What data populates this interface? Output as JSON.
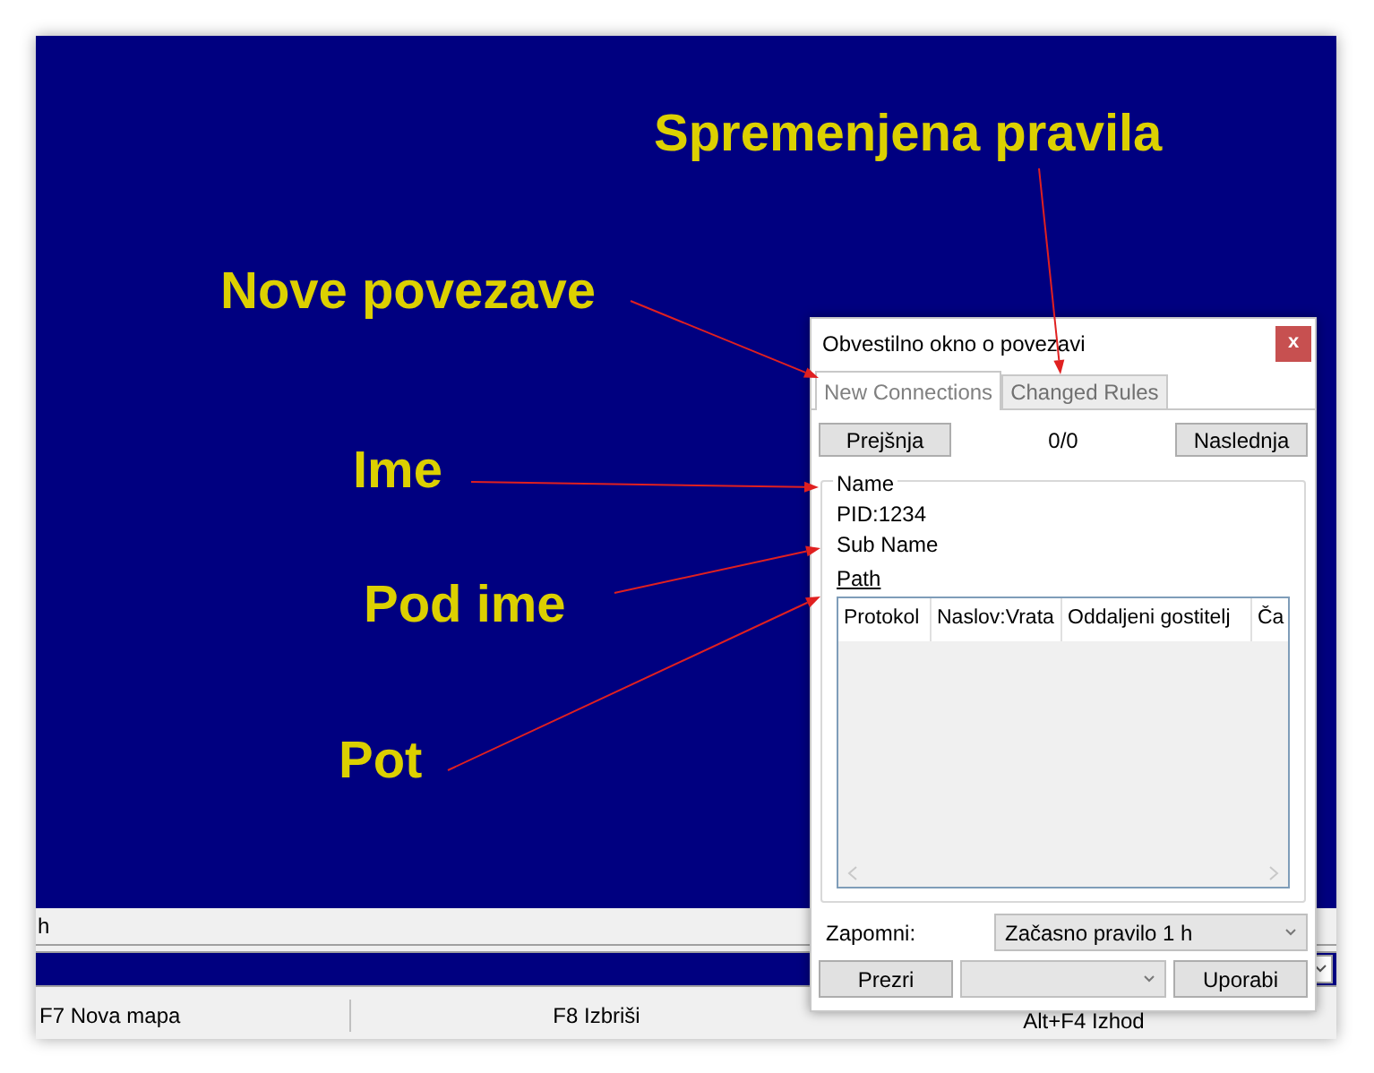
{
  "main_window": {
    "input_text": "h",
    "status_bar": [
      "F7 Nova mapa",
      "F8 Izbriši",
      "Alt+F4 Izhod"
    ]
  },
  "dialog": {
    "title": "Obvestilno okno o povezavi",
    "close": "x",
    "tabs": [
      {
        "label": "New Connections",
        "selected": true
      },
      {
        "label": "Changed Rules",
        "selected": false
      }
    ],
    "previous": "Prejšnja",
    "counter": "0/0",
    "next": "Naslednja",
    "group_title": "Name",
    "pid": "PID:1234",
    "sub_name": "Sub Name",
    "path": "Path",
    "table": {
      "columns": [
        "Protokol",
        "Naslov:Vrata",
        "Oddaljeni gostitelj",
        "Ča"
      ]
    },
    "remember_label": "Zapomni:",
    "remember_value": "Začasno pravilo 1 h",
    "ignore": "Prezri",
    "apply": "Uporabi"
  },
  "annotations": [
    {
      "text": "Spremenjena pravila"
    },
    {
      "text": "Nove povezave"
    },
    {
      "text": "Ime"
    },
    {
      "text": "Pod ime"
    },
    {
      "text": "Pot"
    }
  ]
}
